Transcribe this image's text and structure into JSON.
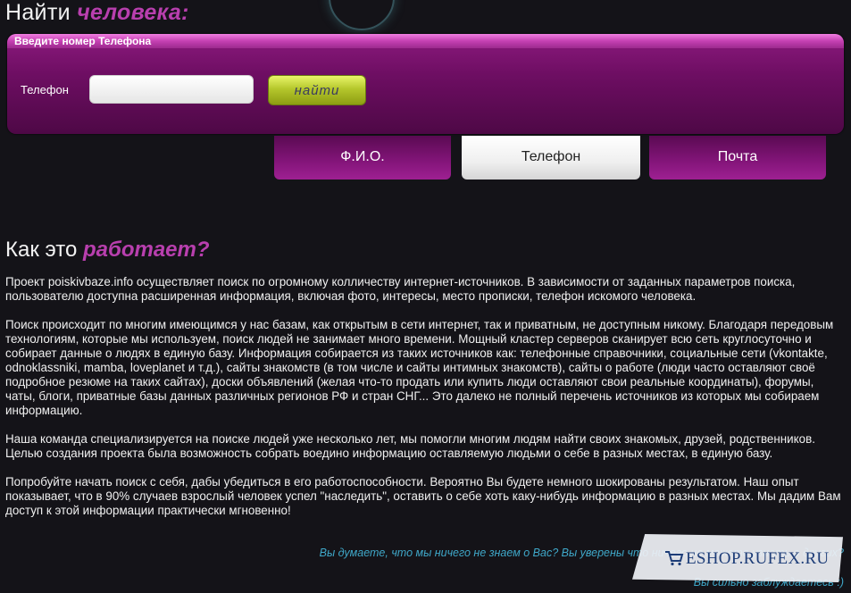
{
  "header": {
    "title_prefix": "Найти",
    "title_accent": "человека:"
  },
  "search": {
    "panel_title": "Введите номер Телефона",
    "field_label": "Телефон",
    "input_value": "",
    "button_label": "найти"
  },
  "tabs": [
    {
      "label": "Ф.И.О.",
      "active": false
    },
    {
      "label": "Телефон",
      "active": true
    },
    {
      "label": "Почта",
      "active": false
    }
  ],
  "about": {
    "heading_prefix": "Как это",
    "heading_accent": "работает?",
    "paragraphs": [
      "Проект poiskivbaze.info осуществляет поиск по огромному колличеству интернет-источников. В зависимости от заданных параметров поиска, пользователю доступна расширенная информация, включая фото, интересы, место прописки, телефон искомого человека.",
      "Поиск происходит по многим имеющимся у нас базам, как открытым в сети интернет, так и приватным, не доступным никому. Благодаря передовым технологиям, которые мы используем, поиск людей не занимает много времени. Мощный кластер серверов сканирует всю сеть круглосуточно и собирает данные о людях в единую базу. Информация собирается из таких источников как: телефонные справочники, социальные сети (vkontakte, odnoklassniki, mamba, loveplanet и т.д.), сайты знакомств (в том числе и сайты интимных знакомств), сайты о работе (люди часто оставляют своё подробное резюме на таких сайтах), доски объявлений (желая что-то продать или купить люди оставляют свои реальные координаты), форумы, чаты, блоги, приватные базы данных различных регионов РФ и стран СНГ... Это далеко не полный перечень источников из которых мы собираем информацию.",
      "Наша команда специализируется на поиске людей уже несколько лет, мы помогли многим людям найти своих знакомых, друзей, родственников. Целью создания проекта была возможность собрать воедино информацию оставляемую людьми о себе в разных местах, в единую базу.",
      "Попробуйте начать поиск с себя, дабы убедиться в его работоспособности. Вероятно Вы будете немного шокированы результатом. Наш опыт показывает, что в 90% случаев взрослый человек успел \"наследить\", оставить о себе хоть каку-нибудь информацию в разных местах. Мы дадим Вам доступ к этой информации практически мгновенно!"
    ],
    "tagline_1": "Вы думаете, что мы ничего не знаем о Вас? Вы уверены что ничего не можете узнать о других?",
    "tagline_2": "Вы сильно заблуждаетесь :)"
  },
  "watermark": {
    "text": "ESHOP.RUFEX.RU",
    "icon": "cart-icon"
  },
  "colors": {
    "background": "#141318",
    "accent_purple": "#b83fae",
    "panel_magenta": "#7a1270",
    "button_lime": "#c8d83a",
    "tagline_blue": "#3fa8c9"
  }
}
